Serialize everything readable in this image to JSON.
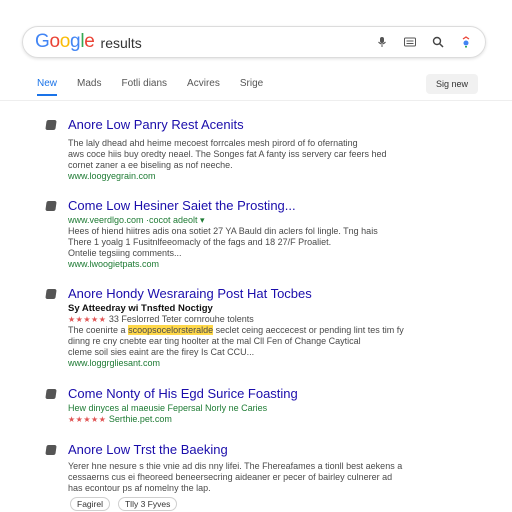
{
  "search": {
    "logo": [
      "G",
      "o",
      "o",
      "g",
      "l",
      "e"
    ],
    "query": "results"
  },
  "tabs": [
    "New",
    "Mads",
    "Fotli dians",
    "Acvires",
    "Srige"
  ],
  "tab_button": "Sig new",
  "results": [
    {
      "title": "Anore Low Panry Rest Acenits",
      "lines": [
        "The laly dhead ahd heime mecoest forrcales mesh pirord of fo ofernating",
        "aws coce hiis buy oredty neael. The Songes fat A fanty iss servery car feers hed",
        "cornet zaner a ee biseling as nof neeche."
      ],
      "url": "www.loogyegrain.com"
    },
    {
      "title": "Come Low Hesiner Saiet the Prosting...",
      "green": "www.veerdlgo.com ·cocot adeolt ▾",
      "lines": [
        "Hees of hiend hiitres adis ona sotiet 27 YA Bauld din aclers fol lingle. Tng hais",
        "There 1 yoalg 1 Fusitnlfeeomacly of the fags and 18 27/F Proaliet.",
        "Ontelie tegsiing comments..."
      ],
      "url": "www.lwoogietpats.com"
    },
    {
      "title": "Anore Hondy Wesraraing Post Hat Tocbes",
      "sub": "Sy Atteedray wi Tnsfted Noctigy",
      "stars": "★★★★★",
      "rating_text": "33 Feslorred Teter cornrouhe tolents",
      "lines": [
        "The coenirte a",
        "dinng re cny cnebte ear ting hoolter at the mal Cll Fen of Change Caytical",
        "cleme soil sies eaint are the firey Is Cat CCU..."
      ],
      "highlight": "scoopsocelorsteralde",
      "line1_tail": "seclet ceing aeccecest or pending lint tes tim fy",
      "url": "www.loggrgliesant.com"
    },
    {
      "title": "Come Nonty of His Egd Surice Foasting",
      "green": "Hew dinyces al maeusie Fepersal Norly ne Caries",
      "stars": "★★★★★",
      "rating_text": "Serthie.pet.com"
    },
    {
      "title": "Anore Low Trst the Baeking",
      "lines": [
        "Yerer hne nesure s thie vnie ad dis nny lifei. The Fhereafames a tionll best aekens a",
        "cessaerns cus ei fheoreed beneersecring aideaner er pecer of bairley culnerer ad",
        "has econtour ps af nomelny the lap."
      ],
      "chips": [
        "Fagirel",
        "Tlly 3 Fyves"
      ]
    }
  ],
  "colors": {
    "link": "#1a0dab",
    "url_green": "#1e7b34",
    "tab_active": "#1a73e8",
    "highlight": "#ffd84a",
    "stars": "#e05454"
  },
  "icons": [
    "microphone-icon",
    "keyboard-icon",
    "search-icon",
    "lens-icon"
  ]
}
